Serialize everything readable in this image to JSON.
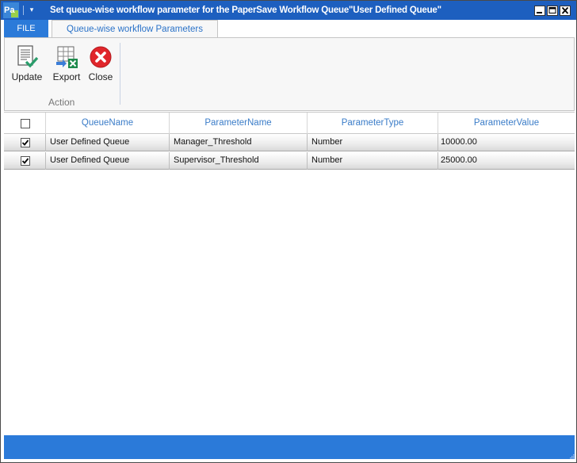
{
  "window": {
    "title": "Set queue-wise workflow parameter for the PaperSave Workflow Queue\"User Defined Queue\"",
    "app_icon_text": "Pa",
    "qat_menu_glyph": "▾",
    "accent_color": "#1d5fbf"
  },
  "tabs": {
    "file_label": "FILE",
    "active_label": "Queue-wise workflow Parameters"
  },
  "ribbon": {
    "buttons": [
      {
        "label": "Update",
        "icon": "update-document-icon"
      },
      {
        "label": "Export",
        "icon": "export-excel-icon"
      },
      {
        "label": "Close",
        "icon": "close-red-circle-icon"
      }
    ],
    "group_label": "Action"
  },
  "grid": {
    "columns": [
      "QueueName",
      "ParameterName",
      "ParameterType",
      "ParameterValue"
    ],
    "rows": [
      {
        "checked": true,
        "queue_name": "User Defined Queue",
        "parameter_name": "Manager_Threshold",
        "parameter_type": "Number",
        "parameter_value": "10000.00"
      },
      {
        "checked": true,
        "queue_name": "User Defined Queue",
        "parameter_name": "Supervisor_Threshold",
        "parameter_type": "Number",
        "parameter_value": "25000.00"
      }
    ]
  },
  "colors": {
    "status_bar": "#2b7ad9",
    "header_text": "#3a7cc8",
    "close_icon": "#e0262b"
  }
}
